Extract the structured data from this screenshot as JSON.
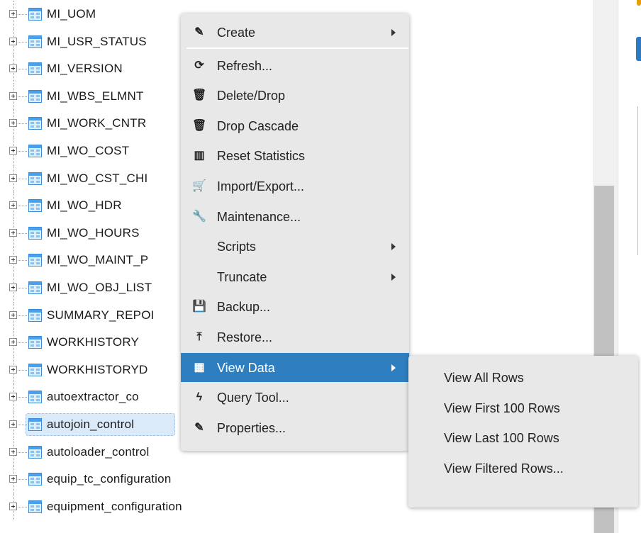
{
  "tree": {
    "items": [
      {
        "label": "MI_UOM"
      },
      {
        "label": "MI_USR_STATUS"
      },
      {
        "label": "MI_VERSION"
      },
      {
        "label": "MI_WBS_ELMNT"
      },
      {
        "label": "MI_WORK_CNTR"
      },
      {
        "label": "MI_WO_COST"
      },
      {
        "label": "MI_WO_CST_CHI"
      },
      {
        "label": "MI_WO_HDR"
      },
      {
        "label": "MI_WO_HOURS"
      },
      {
        "label": "MI_WO_MAINT_P"
      },
      {
        "label": "MI_WO_OBJ_LIST"
      },
      {
        "label": "SUMMARY_REPOI"
      },
      {
        "label": "WORKHISTORY"
      },
      {
        "label": "WORKHISTORYD"
      },
      {
        "label": "autoextractor_co"
      },
      {
        "label": "autojoin_control",
        "selected": true
      },
      {
        "label": "autoloader_control"
      },
      {
        "label": "equip_tc_configuration"
      },
      {
        "label": "equipment_configuration"
      }
    ]
  },
  "context_menu": {
    "items": [
      {
        "label": "Create",
        "icon": "magic-wand-icon",
        "glyph": "✎",
        "has_submenu": true
      },
      {
        "label": "Refresh...",
        "icon": "refresh-icon",
        "glyph": "⟳"
      },
      {
        "label": "Delete/Drop",
        "icon": "trash-icon",
        "glyph": "🗑"
      },
      {
        "label": "Drop Cascade",
        "icon": "trash-icon",
        "glyph": "🗑"
      },
      {
        "label": "Reset Statistics",
        "icon": "bar-chart-icon",
        "glyph": "▥"
      },
      {
        "label": "Import/Export...",
        "icon": "shopping-cart-icon",
        "glyph": "🛒"
      },
      {
        "label": "Maintenance...",
        "icon": "wrench-icon",
        "glyph": "🔧"
      },
      {
        "label": "Scripts",
        "icon": "",
        "glyph": "",
        "has_submenu": true
      },
      {
        "label": "Truncate",
        "icon": "",
        "glyph": "",
        "has_submenu": true
      },
      {
        "label": "Backup...",
        "icon": "floppy-disk-icon",
        "glyph": "💾"
      },
      {
        "label": "Restore...",
        "icon": "upload-icon",
        "glyph": "⤒"
      },
      {
        "label": "View Data",
        "icon": "grid-icon",
        "glyph": "▦",
        "has_submenu": true,
        "active": true
      },
      {
        "label": "Query Tool...",
        "icon": "lightning-icon",
        "glyph": "ϟ"
      },
      {
        "label": "Properties...",
        "icon": "edit-icon",
        "glyph": "✎"
      }
    ]
  },
  "view_data_submenu": {
    "items": [
      {
        "label": "View All Rows"
      },
      {
        "label": "View First 100 Rows"
      },
      {
        "label": "View Last 100 Rows"
      },
      {
        "label": "View Filtered Rows..."
      }
    ]
  },
  "colors": {
    "active_highlight": "#2f7fc0",
    "menu_background": "#e8e8e8",
    "selected_row": "#dbeaf8"
  }
}
